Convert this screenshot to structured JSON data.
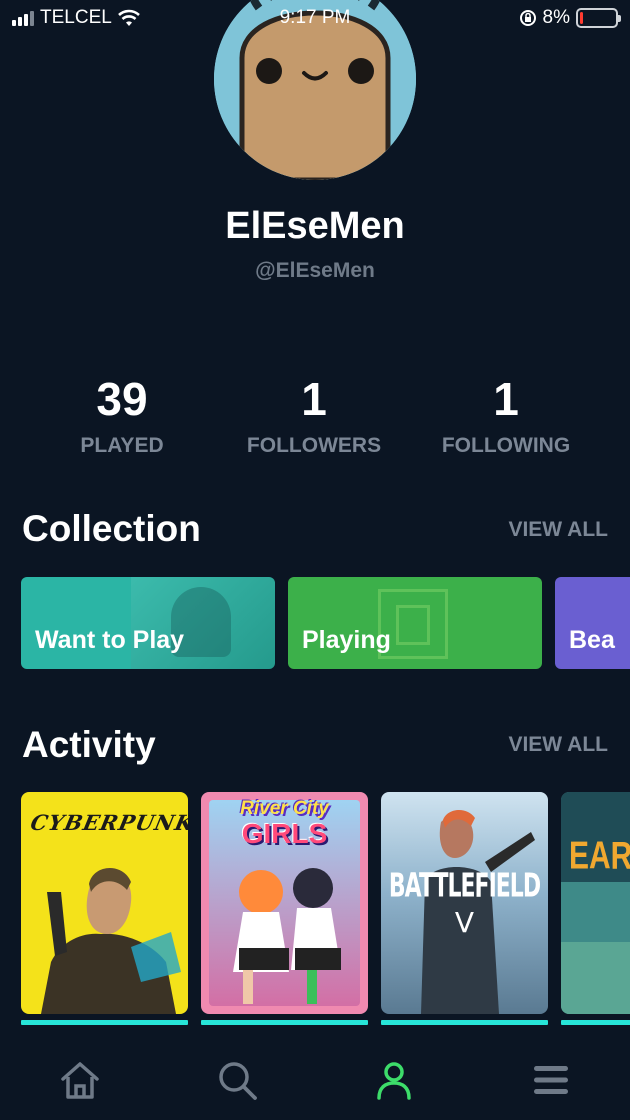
{
  "status_bar": {
    "carrier": "TELCEL",
    "time": "9:17 PM",
    "battery": "8%",
    "battery_level": 0.08
  },
  "profile": {
    "name": "ElEseMen",
    "handle": "@ElEseMen"
  },
  "stats": [
    {
      "value": "39",
      "label": "PLAYED"
    },
    {
      "value": "1",
      "label": "FOLLOWERS"
    },
    {
      "value": "1",
      "label": "FOLLOWING"
    }
  ],
  "collection": {
    "title": "Collection",
    "view_all": "VIEW ALL",
    "cards": [
      {
        "label": "Want to Play",
        "color": "#2bb5a5"
      },
      {
        "label": "Playing",
        "color": "#3cb04a"
      },
      {
        "label": "Bea",
        "color": "#6a5fd1"
      }
    ]
  },
  "activity": {
    "title": "Activity",
    "view_all": "VIEW ALL",
    "games": [
      {
        "title_art": "CYBERPUNK",
        "progress": 1.0
      },
      {
        "title_art_line1": "River City",
        "title_art_line2": "GIRLS",
        "progress": 1.0
      },
      {
        "title_art_line1": "BATTLEFIELD",
        "title_art_line2": "V",
        "progress": 1.0
      },
      {
        "title_art": "EAR",
        "progress": 1.0
      }
    ]
  },
  "nav": {
    "items": [
      {
        "icon": "home-icon"
      },
      {
        "icon": "search-icon"
      },
      {
        "icon": "profile-icon",
        "active": true
      },
      {
        "icon": "menu-icon"
      }
    ],
    "active_color": "#3ddc6a",
    "inactive_color": "#6f7a88"
  }
}
